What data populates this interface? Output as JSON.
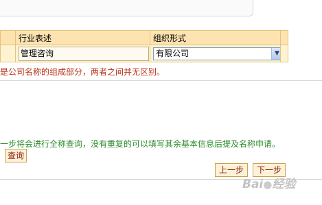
{
  "table": {
    "headers": [
      "",
      "行业表述",
      "组织形式"
    ],
    "industry_value": "管理咨询",
    "org_form": {
      "selected": "有限公司"
    }
  },
  "notice_text": "是公司名称的组成部分，两者之间并无区别。",
  "hint_text": "一步将会进行全称查询，没有重复的可以填写其余基本信息后提及名称申请。",
  "buttons": {
    "query": "查询",
    "prev": "上一步",
    "next": "下一步"
  },
  "watermark": {
    "text": "Bai",
    "suffix": "经验"
  },
  "colors": {
    "header_bg": "#fde3b0",
    "notice": "#b8331a",
    "hint": "#2b8a2b"
  }
}
